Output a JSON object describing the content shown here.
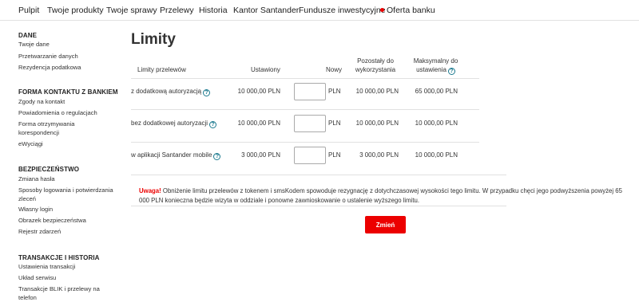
{
  "topnav": {
    "items": [
      "Pulpit",
      "Twoje produkty",
      "Twoje sprawy",
      "Przelewy",
      "Historia",
      "Kantor Santander",
      "Fundusze inwestycyjne"
    ],
    "offer": "Oferta banku",
    "accent_color": "#ec0000"
  },
  "sidebar": {
    "sections": [
      {
        "heading": "DANE",
        "items": [
          "Twoje dane",
          "Przetwarzanie danych",
          "Rezydencja podatkowa"
        ]
      },
      {
        "heading": "FORMA KONTAKTU Z BANKIEM",
        "items": [
          "Zgody na kontakt",
          "Powiadomienia o regulacjach",
          "Forma otrzymywania korespondencji",
          "eWyciągi"
        ]
      },
      {
        "heading": "BEZPIECZEŃSTWO",
        "items": [
          "Zmiana hasła",
          "Sposoby logowania i potwierdzania zleceń",
          "Własny login",
          "Obrazek bezpieczeństwa",
          "Rejestr zdarzeń"
        ]
      },
      {
        "heading": "TRANSAKCJE I HISTORIA",
        "items": [
          "Ustawienia transakcji",
          "Układ serwisu",
          "Transakcje BLIK i przelewy na telefon"
        ]
      }
    ]
  },
  "main": {
    "title": "Limity",
    "headers": {
      "limit": "Limity przelewów",
      "set": "Ustawiony",
      "new": "Nowy",
      "remaining": "Pozostały do wykorzystania",
      "max": "Maksymalny do ustawienia"
    },
    "currency": "PLN",
    "rows": [
      {
        "label": "z dodatkową autoryzacją",
        "set": "10 000,00 PLN",
        "new": "",
        "remaining": "10 000,00 PLN",
        "max": "65 000,00 PLN"
      },
      {
        "label": "bez dodatkowej autoryzacji",
        "set": "10 000,00 PLN",
        "new": "",
        "remaining": "10 000,00 PLN",
        "max": "10 000,00 PLN"
      },
      {
        "label": "w aplikacji Santander mobile",
        "set": "3 000,00 PLN",
        "new": "",
        "remaining": "3 000,00 PLN",
        "max": "10 000,00 PLN"
      }
    ],
    "warning_label": "Uwaga!",
    "warning_text": " Obniżenie limitu przelewów z tokenem i smsKodem spowoduje rezygnację z dotychczasowej wysokości tego limitu. W przypadku chęci jego podwyższenia powyżej 65 000 PLN konieczna będzie wizyta w oddziale i ponowne zawnioskowanie o ustalenie wyższego limitu.",
    "submit": "Zmień",
    "help_icon": "question-circle-icon"
  }
}
